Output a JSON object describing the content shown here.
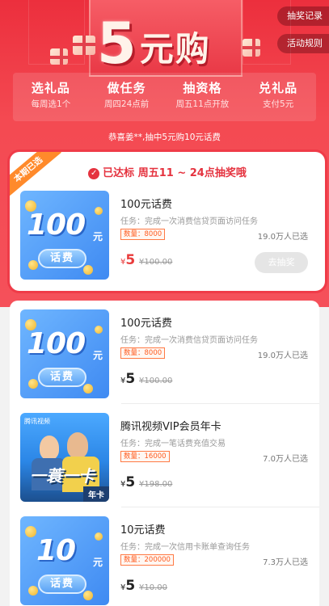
{
  "hero": {
    "title_number": "5",
    "title_text": "元购",
    "record_button": "抽奖记录",
    "rules_button": "活动规则",
    "steps": [
      {
        "title": "选礼品",
        "sub": "每周选1个"
      },
      {
        "title": "做任务",
        "sub": "周四24点前"
      },
      {
        "title": "抽资格",
        "sub": "周五11点开放"
      },
      {
        "title": "兑礼品",
        "sub": "支付5元"
      }
    ],
    "winner_notice": "恭喜姜**,抽中5元购10元话费"
  },
  "current": {
    "corner_badge": "本期已选",
    "qualify_text": "已达标 周五11 ~ 24点抽奖哦",
    "item": {
      "name": "100元话费",
      "task": "任务：完成一次消费信贷页面访问任务",
      "qty": "数量：8000",
      "sold": "19.0万人已选",
      "price_symbol": "¥",
      "price": "5",
      "orig": "¥100.00",
      "action": "去抽奖",
      "thumb_amount": "100",
      "thumb_unit": "元",
      "thumb_tag": "话费"
    }
  },
  "list": [
    {
      "name": "100元话费",
      "task": "任务：完成一次消费信贷页面访问任务",
      "qty": "数量：8000",
      "sold": "19.0万人已选",
      "price_symbol": "¥",
      "price": "5",
      "orig": "¥100.00",
      "thumb_amount": "100",
      "thumb_unit": "元",
      "thumb_tag": "话费"
    },
    {
      "name": "腾讯视频VIP会员年卡",
      "task": "任务：完成一笔话费充值交易",
      "qty": "数量：16000",
      "sold": "7.0万人已选",
      "price_symbol": "¥",
      "price": "5",
      "orig": "¥198.00",
      "thumb_logo": "腾讯视频",
      "thumb_title": "一蓑一卡",
      "thumb_badge": "年卡"
    },
    {
      "name": "10元话费",
      "task": "任务：完成一次信用卡账单查询任务",
      "qty": "数量：200000",
      "sold": "7.3万人已选",
      "price_symbol": "¥",
      "price": "5",
      "orig": "¥10.00",
      "thumb_amount": "10",
      "thumb_unit": "元",
      "thumb_tag": "话费"
    }
  ],
  "colors": {
    "brand_red": "#ec2f3d",
    "price_red": "#e93b3b",
    "badge_orange": "#ff8a2b"
  }
}
